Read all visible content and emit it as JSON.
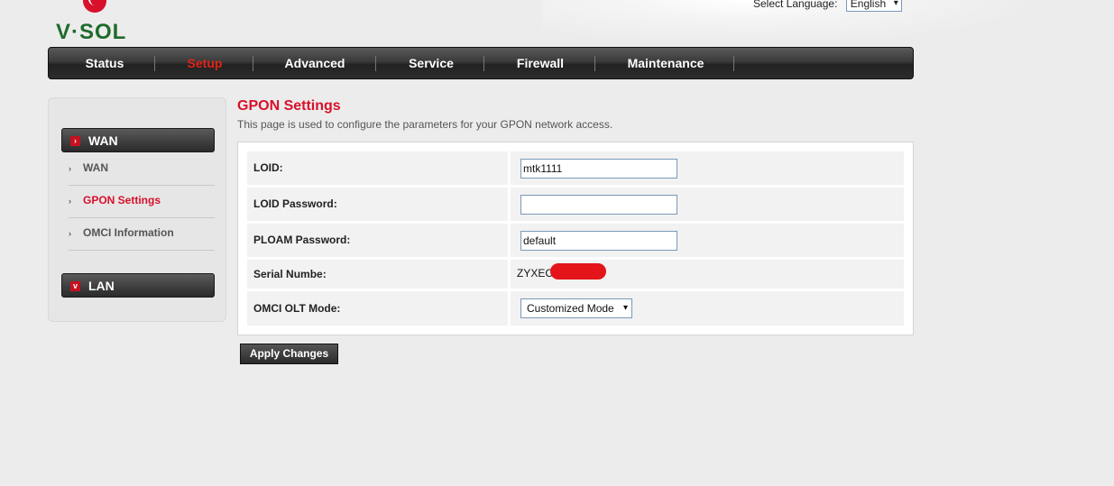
{
  "header": {
    "logo_text": "V·SOL",
    "language_label": "Select Language:",
    "language_value": "English"
  },
  "nav": {
    "items": [
      "Status",
      "Setup",
      "Advanced",
      "Service",
      "Firewall",
      "Maintenance"
    ],
    "active": "Setup"
  },
  "sidebar": {
    "sections": [
      {
        "label": "WAN",
        "links": [
          "WAN",
          "GPON Settings",
          "OMCI Information"
        ]
      },
      {
        "label": "LAN"
      }
    ],
    "active_link": "GPON Settings"
  },
  "main": {
    "title": "GPON Settings",
    "subtitle": "This page is used to configure the parameters for your GPON network access.",
    "form": {
      "loid_label": "LOID:",
      "loid_value": "mtk1111",
      "loid_password_label": "LOID Password:",
      "loid_password_value": "",
      "ploam_password_label": "PLOAM Password:",
      "ploam_password_value": "default",
      "serial_label": "Serial Numbe:",
      "serial_value": "ZYXEC",
      "omci_mode_label": "OMCI OLT Mode:",
      "omci_mode_value": "Customized Mode"
    },
    "apply_label": "Apply Changes"
  },
  "colors": {
    "accent_red": "#d8102a",
    "logo_green": "#1f6b2c",
    "nav_dark": "#2c2c2c"
  }
}
